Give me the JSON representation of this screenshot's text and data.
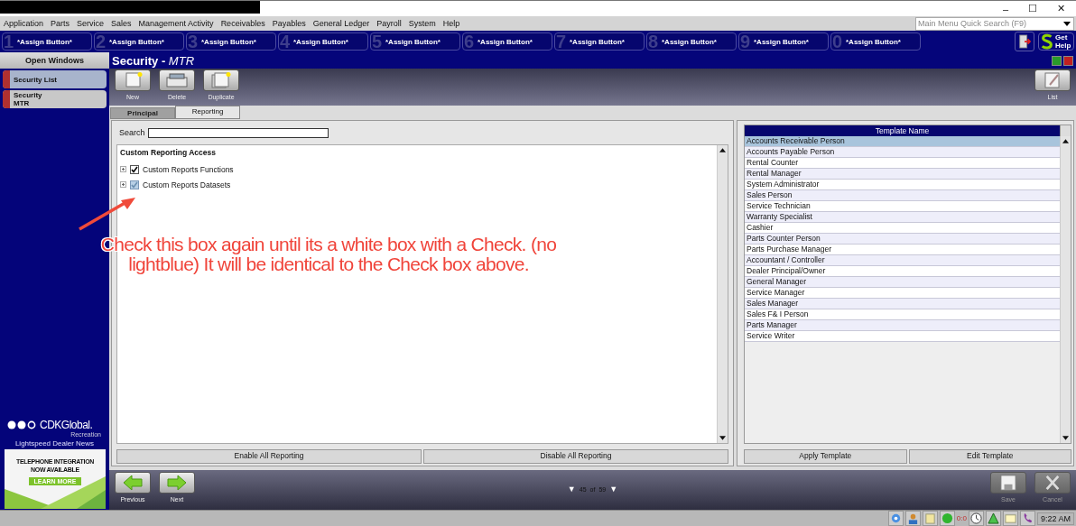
{
  "window_controls": [
    "–",
    "☐",
    "✕"
  ],
  "menu": [
    "Application",
    "Parts",
    "Service",
    "Sales",
    "Management Activity",
    "Receivables",
    "Payables",
    "General Ledger",
    "Payroll",
    "System",
    "Help"
  ],
  "quick_search": {
    "placeholder": "Main Menu Quick Search (F9)"
  },
  "assign_buttons": [
    {
      "key": "1",
      "label": "*Assign Button*"
    },
    {
      "key": "2",
      "label": "*Assign Button*"
    },
    {
      "key": "3",
      "label": "*Assign Button*"
    },
    {
      "key": "4",
      "label": "*Assign Button*"
    },
    {
      "key": "5",
      "label": "*Assign Button*"
    },
    {
      "key": "6",
      "label": "*Assign Button*"
    },
    {
      "key": "7",
      "label": "*Assign Button*"
    },
    {
      "key": "8",
      "label": "*Assign Button*"
    },
    {
      "key": "9",
      "label": "*Assign Button*"
    },
    {
      "key": "0",
      "label": "*Assign Button*"
    }
  ],
  "get_help": {
    "label_1": "Get",
    "label_2": "Help"
  },
  "sidebar": {
    "title": "Open Windows",
    "items": [
      {
        "lines": [
          "Security List"
        ],
        "selected": true
      },
      {
        "lines": [
          "Security",
          "MTR"
        ],
        "selected": false
      }
    ],
    "logo": {
      "name": "CDKGlobal.",
      "sub": "Recreation"
    },
    "news_title": "Lightspeed Dealer News",
    "ad": {
      "headline_1": "TELEPHONE INTEGRATION",
      "headline_2": "NOW AVAILABLE",
      "button": "LEARN MORE"
    }
  },
  "header": {
    "title": "Security",
    "separator": "-",
    "subtitle": "MTR"
  },
  "toolbar": [
    {
      "kind": "new",
      "label": "New"
    },
    {
      "kind": "delete",
      "label": "Delete"
    },
    {
      "kind": "duplicate",
      "label": "Duplicate"
    }
  ],
  "list_button": "List",
  "tabs": [
    {
      "label": "Principal",
      "selected": false
    },
    {
      "label": "Reporting",
      "selected": true
    }
  ],
  "search": {
    "label": "Search"
  },
  "tree": {
    "title": "Custom Reporting Access",
    "items": [
      {
        "label": "Custom Reports Functions",
        "checked": true,
        "kind": "full"
      },
      {
        "label": "Custom Reports Datasets",
        "checked": true,
        "kind": "partial"
      }
    ]
  },
  "left_buttons": [
    "Enable All Reporting",
    "Disable All Reporting"
  ],
  "template_table": {
    "column": "Template Name",
    "rows": [
      {
        "name": "Accounts Receivable Person",
        "selected": true
      },
      {
        "name": "Accounts Payable Person",
        "selected": false
      },
      {
        "name": "Rental Counter",
        "selected": false
      },
      {
        "name": "Rental Manager",
        "selected": false
      },
      {
        "name": "System Administrator",
        "selected": false
      },
      {
        "name": "Sales Person",
        "selected": false
      },
      {
        "name": "Service Technician",
        "selected": false
      },
      {
        "name": "Warranty Specialist",
        "selected": false
      },
      {
        "name": "Cashier",
        "selected": false
      },
      {
        "name": "Parts Counter Person",
        "selected": false
      },
      {
        "name": "Parts Purchase Manager",
        "selected": false
      },
      {
        "name": "Accountant / Controller",
        "selected": false
      },
      {
        "name": "Dealer Principal/Owner",
        "selected": false
      },
      {
        "name": "General Manager",
        "selected": false
      },
      {
        "name": "Service Manager",
        "selected": false
      },
      {
        "name": "Sales Manager",
        "selected": false
      },
      {
        "name": "Sales F& I Person",
        "selected": false
      },
      {
        "name": "Parts Manager",
        "selected": false
      },
      {
        "name": "Service Writer",
        "selected": false
      }
    ]
  },
  "right_buttons": [
    "Apply Template",
    "Edit Template"
  ],
  "nav": {
    "previous": "Previous",
    "next": "Next",
    "pager": {
      "prev_glyph": "▼",
      "current": "45",
      "of": "of",
      "total": "59",
      "next_glyph": "▼"
    },
    "save": {
      "label": "Save",
      "disabled": true
    },
    "cancel": {
      "label": "Cancel",
      "disabled": true
    }
  },
  "annotation": {
    "text": "Check this box again until its a white box with a Check. (no lightblue) It will be identical to the Check box above."
  },
  "status_bar": {
    "counter": "0:0",
    "time": "9:22 AM"
  }
}
